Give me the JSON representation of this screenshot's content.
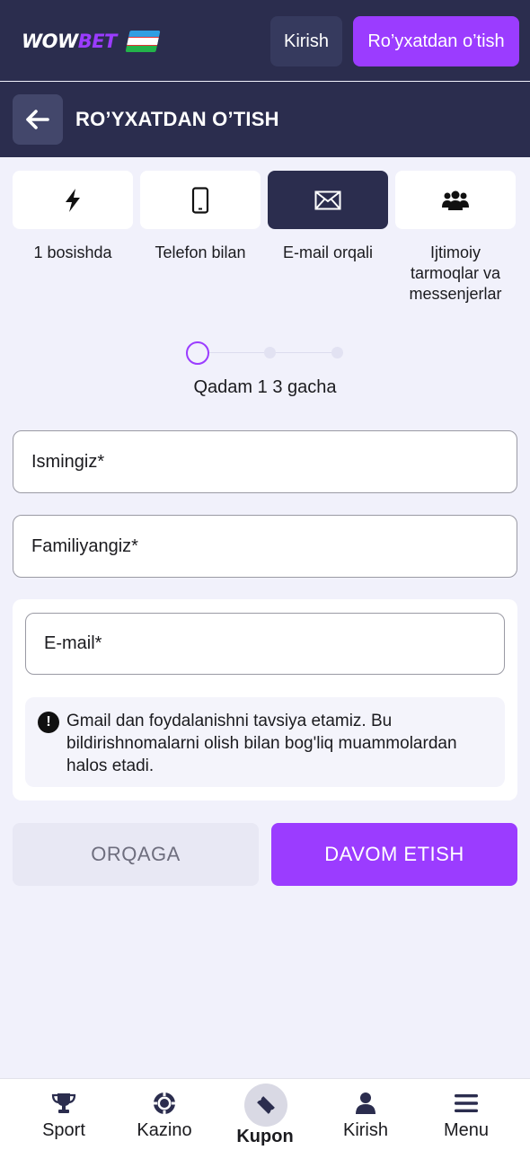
{
  "header": {
    "logo_wow": "WOW",
    "logo_bet": "BET",
    "login_label": "Kirish",
    "register_label": "Ro’yxatdan o’tish"
  },
  "titlebar": {
    "title": "RO’YXATDAN O’TISH",
    "back_icon": "arrow-left-icon"
  },
  "methods": [
    {
      "label": "1 bosishda",
      "icon": "lightning-icon",
      "active": false
    },
    {
      "label": "Telefon bilan",
      "icon": "phone-icon",
      "active": false
    },
    {
      "label": "E-mail orqali",
      "icon": "envelope-icon",
      "active": true
    },
    {
      "label": "Ijtimoiy tarmoqlar va messenjerlar",
      "icon": "users-icon",
      "active": false
    }
  ],
  "stepper": {
    "current": 1,
    "total": 3,
    "caption": "Qadam 1 3 gacha"
  },
  "form": {
    "first_name_placeholder": "Ismingiz*",
    "last_name_placeholder": "Familiyangiz*",
    "email_placeholder": "E-mail*",
    "notice": "Gmail dan foydalanishni tavsiya etamiz. Bu bildirishnomalarni olish bilan bog'liq muammolardan halos etadi.",
    "notice_icon": "exclamation-circle-icon"
  },
  "actions": {
    "back_label": "ORQAGA",
    "continue_label": "DAVOM ETISH"
  },
  "bottom_nav": [
    {
      "label": "Sport",
      "icon": "trophy-icon",
      "active": false
    },
    {
      "label": "Kazino",
      "icon": "casino-chip-icon",
      "active": false
    },
    {
      "label": "Kupon",
      "icon": "ticket-icon",
      "active": true
    },
    {
      "label": "Kirish",
      "icon": "user-icon",
      "active": false
    },
    {
      "label": "Menu",
      "icon": "hamburger-icon",
      "active": false
    }
  ],
  "colors": {
    "header_bg": "#2b2d4e",
    "accent": "#9b3cff",
    "page_bg": "#f1f1fb"
  }
}
